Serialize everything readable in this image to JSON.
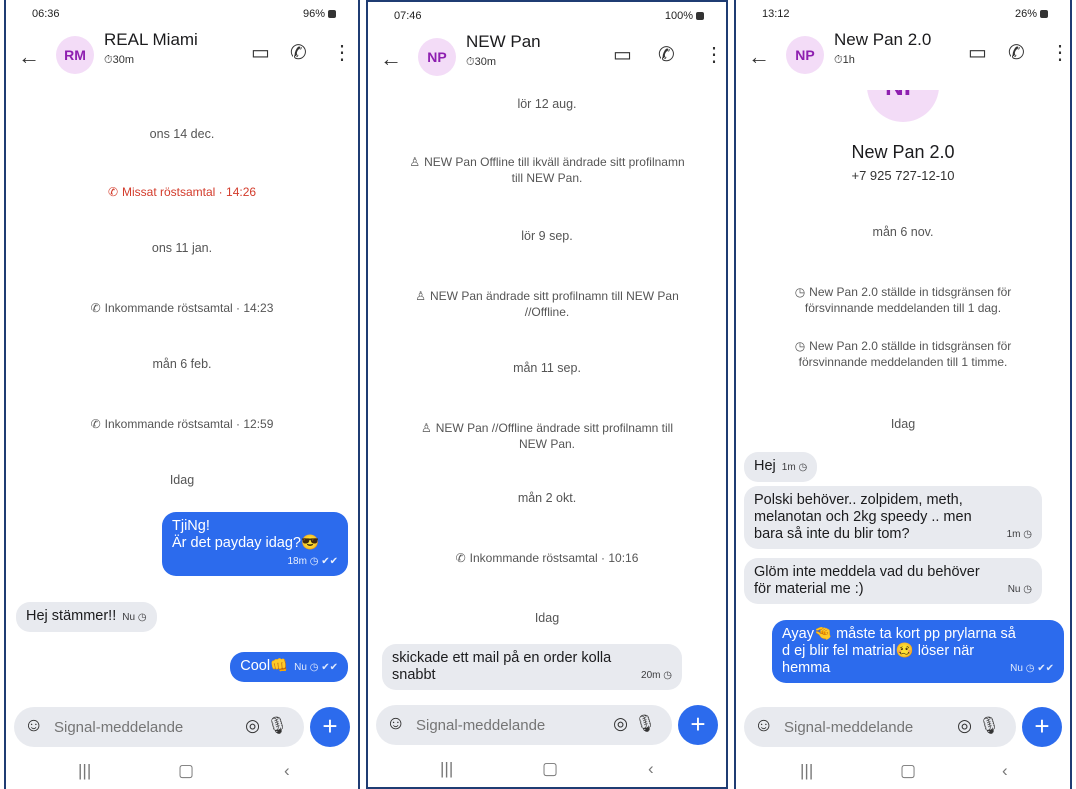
{
  "phones": [
    {
      "status": {
        "time": "06:36",
        "right": "96%"
      },
      "header": {
        "avatar": "RM",
        "name": "REAL Miami",
        "timer": "30m"
      },
      "events": {
        "date1": "ons 14 dec.",
        "missed_call": "Missat röstsamtal · 14:26",
        "date2": "ons 11 jan.",
        "call1": "Inkommande röstsamtal · 14:23",
        "date3": "mån 6 feb.",
        "call2": "Inkommande röstsamtal · 12:59",
        "today": "Idag"
      },
      "messages": [
        {
          "line1": "TjiNg!",
          "line2": "Är det payday idag?",
          "emoji": "😎",
          "meta": "18m"
        },
        {
          "text": "Hej stämmer!!",
          "meta": "Nu"
        },
        {
          "text": "Cool",
          "emoji": "👊",
          "meta": "Nu"
        }
      ],
      "composer": {
        "placeholder": "Signal-meddelande"
      }
    },
    {
      "status": {
        "time": "07:46",
        "right": "100%"
      },
      "header": {
        "avatar": "NP",
        "name": "NEW Pan",
        "timer": "30m"
      },
      "events": {
        "date1": "lör 12 aug.",
        "change1": "NEW Pan Offline till ikväll ändrade sitt profilnamn till NEW Pan.",
        "date2": "lör 9 sep.",
        "change2": "NEW Pan ändrade sitt profilnamn till NEW Pan //Offline.",
        "date3": "mån 11 sep.",
        "change3": "NEW Pan //Offline ändrade sitt profilnamn till NEW Pan.",
        "date4": "mån 2 okt.",
        "call1": "Inkommande röstsamtal · 10:16",
        "today": "Idag"
      },
      "messages": [
        {
          "line1": "skickade ett mail på en order kolla",
          "line2": "snabbt",
          "meta": "20m"
        }
      ],
      "composer": {
        "placeholder": "Signal-meddelande"
      }
    },
    {
      "status": {
        "time": "13:12",
        "right": "26%"
      },
      "header": {
        "avatar": "NP",
        "name": "New Pan 2.0",
        "timer": "1h"
      },
      "profile": {
        "initials": "NP",
        "name": "New Pan 2.0",
        "phone": "+7 925 727-12-10"
      },
      "events": {
        "date1": "mån 6 nov.",
        "timer1": "New Pan 2.0 ställde in tidsgränsen för försvinnande meddelanden till 1 dag.",
        "timer2": "New Pan 2.0 ställde in tidsgränsen för försvinnande meddelanden till 1 timme.",
        "today": "Idag"
      },
      "messages": [
        {
          "text": "Hej",
          "meta": "1m"
        },
        {
          "line1": "Polski behöver.. zolpidem, meth,",
          "line2": "melanotan och 2kg speedy .. men",
          "line3": "bara så inte du blir tom?",
          "meta": "1m"
        },
        {
          "line1": "Glöm inte meddela vad du behöver",
          "line2": "för material me :)",
          "meta": "Nu"
        },
        {
          "part1": "Ayay",
          "emoji1": "🤏",
          "part2": "måste ta kort pp prylarna så",
          "line2a": "d ej blir fel matrial",
          "emoji2": "🥴",
          "line2b": "löser när",
          "line3": "hemma",
          "meta": "Nu"
        }
      ],
      "composer": {
        "placeholder": "Signal-meddelande"
      }
    }
  ]
}
